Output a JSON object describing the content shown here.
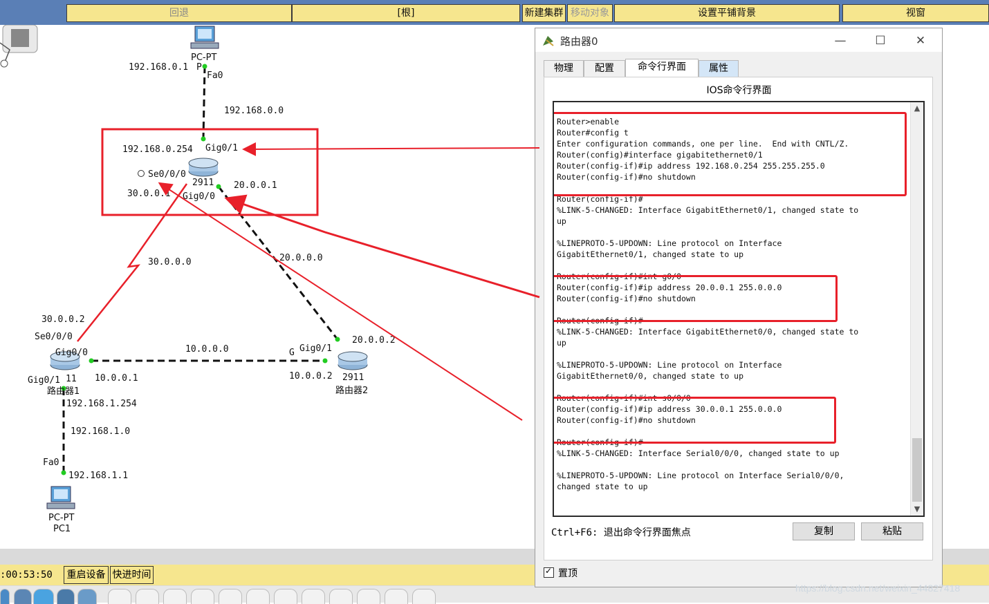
{
  "toolbar": {
    "back": "回退",
    "root": "[根]",
    "new_cluster": "新建集群",
    "move_object": "移动对象",
    "set_tiled_bg": "设置平铺背景",
    "viewport": "视窗"
  },
  "topology": {
    "pc_top_label": "PC-PT",
    "pc_top_fa": "Fa0",
    "pc_top_ip": "192.168.0.1",
    "pc_top_name_partial": "P",
    "net_top": "192.168.0.0",
    "r0_gig01_ip": "192.168.0.254",
    "r0_gig01": "Gig0/1",
    "r0_se000": "Se0/0/0",
    "r0_model": "2911",
    "r0_gig00_ip": "20.0.0.1",
    "r0_se_ip": "30.0.0.1",
    "r0_gig00": "Gig0/0",
    "net_left": "30.0.0.0",
    "net_right": "20.0.0.0",
    "r1_se_ip": "30.0.0.2",
    "r1_se": "Se0/0/0",
    "r1_gig00": "Gig0/0",
    "net_bottom": "10.0.0.0",
    "r2_gig01": "Gig0/1",
    "r2_gig_partial": "G",
    "r2_gig_ip": "20.0.0.2",
    "r1_gig01": "Gig0/1",
    "r1_model_partial": "11",
    "r1_gig00_ip": "10.0.0.1",
    "r2_gig00_ip": "10.0.0.2",
    "r2_model": "2911",
    "r1_name": "路由器1",
    "r2_name": "路由器2",
    "r1_lan_ip": "192.168.1.254",
    "net_lan1": "192.168.1.0",
    "pc1_fa": "Fa0",
    "pc1_ip": "192.168.1.1",
    "pc1_label": "PC-PT",
    "pc1_name": "PC1"
  },
  "status_bar": {
    "clock": ":00:53:50",
    "restart": "重启设备",
    "fast_forward": "快进时间"
  },
  "dialog": {
    "title": "路由器0",
    "tabs": [
      "物理",
      "配置",
      "命令行界面",
      "属性"
    ],
    "ios_title": "IOS命令行界面",
    "console_text": "\nRouter>enable\nRouter#config t\nEnter configuration commands, one per line.  End with CNTL/Z.\nRouter(config)#interface gigabitethernet0/1\nRouter(config-if)#ip address 192.168.0.254 255.255.255.0\nRouter(config-if)#no shutdown\n\nRouter(config-if)#\n%LINK-5-CHANGED: Interface GigabitEthernet0/1, changed state to\nup\n\n%LINEPROTO-5-UPDOWN: Line protocol on Interface\nGigabitEthernet0/1, changed state to up\n\nRouter(config-if)#int g0/0\nRouter(config-if)#ip address 20.0.0.1 255.0.0.0\nRouter(config-if)#no shutdown\n\nRouter(config-if)#\n%LINK-5-CHANGED: Interface GigabitEthernet0/0, changed state to\nup\n\n%LINEPROTO-5-UPDOWN: Line protocol on Interface\nGigabitEthernet0/0, changed state to up\n\nRouter(config-if)#int s0/0/0\nRouter(config-if)#ip address 30.0.0.1 255.0.0.0\nRouter(config-if)#no shutdown\n\nRouter(config-if)#\n%LINK-5-CHANGED: Interface Serial0/0/0, changed state to up\n\n%LINEPROTO-5-UPDOWN: Line protocol on Interface Serial0/0/0,\nchanged state to up",
    "hint": "Ctrl+F6: 退出命令行界面焦点",
    "copy": "复制",
    "paste": "粘贴",
    "pin": "置顶"
  },
  "watermark": "https://blog.csdn.net/weixin_44827418",
  "colors": {
    "accent": "#f6e68e",
    "annotation": "#e8202a",
    "link_ok": "#22cc22"
  }
}
